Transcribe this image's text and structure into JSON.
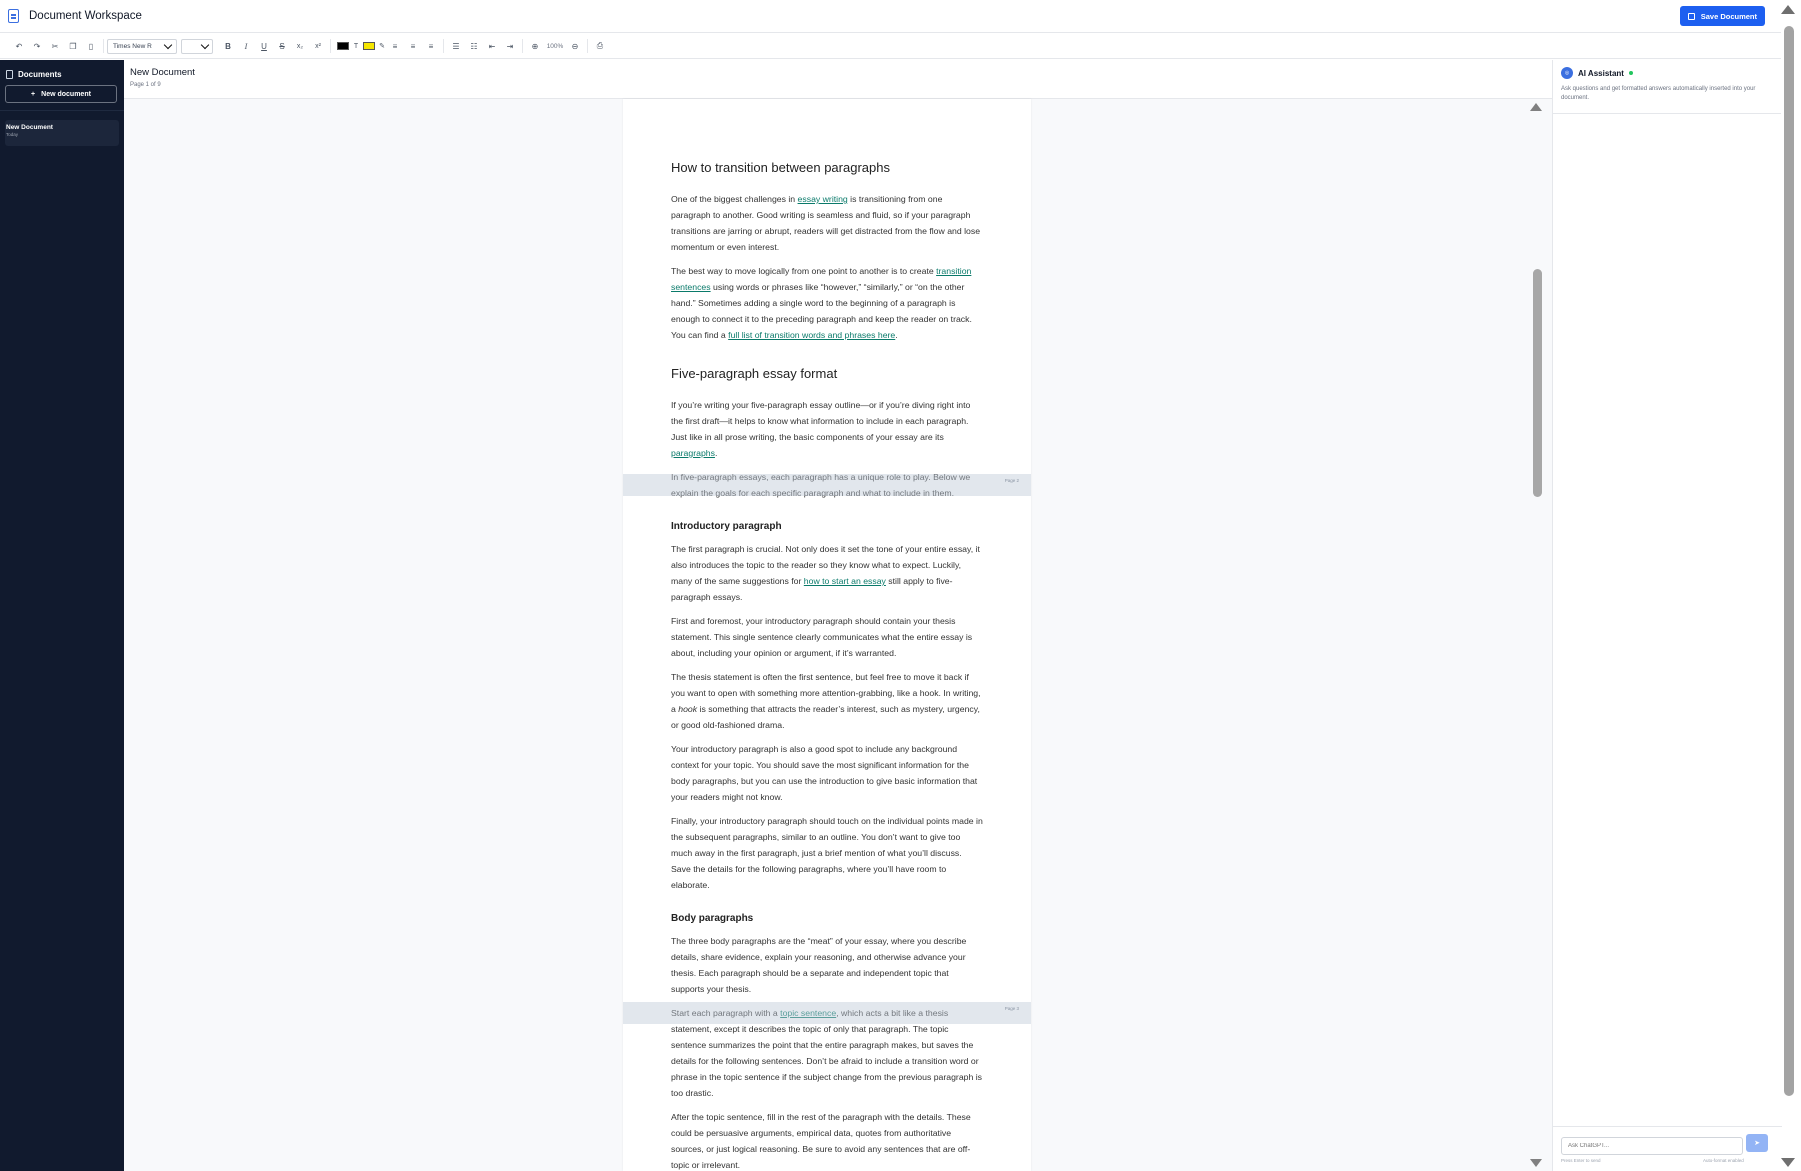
{
  "app": {
    "title": "Document Workspace",
    "save_label": "Save Document"
  },
  "toolbar": {
    "font": "Times New R",
    "zoom": "100%",
    "text_color": "#000000",
    "highlight_color": "#f5e600"
  },
  "sidebar": {
    "heading": "Documents",
    "new_label": "New document",
    "items": [
      {
        "name": "New Document",
        "date": "Today"
      }
    ]
  },
  "document": {
    "title": "New Document",
    "pages": "Page 1 of 9",
    "page_labels": [
      "Page 2",
      "Page 3"
    ],
    "h_transition": "How to transition between paragraphs",
    "p1": {
      "a": "One of the biggest challenges in ",
      "link": "essay writing",
      "b": " is transitioning from one paragraph to another. Good writing is seamless and fluid, so if your paragraph transitions are jarring or abrupt, readers will get distracted from the flow and lose momentum or even interest."
    },
    "p2": {
      "a": "The best way to move logically from one point to another is to create ",
      "link1": "transition sentences",
      "b": " using words or phrases like “however,” “similarly,” or “on the other hand.” Sometimes adding a single word to the beginning of a paragraph is enough to connect it to the preceding paragraph and keep the reader on track. You can find a ",
      "link2": "full list of transition words and phrases here",
      "c": "."
    },
    "h_five": "Five-paragraph essay format",
    "p3": {
      "a": "If you’re writing your five-paragraph essay outline—or if you’re diving right into the first draft—it helps to know what information to include in each paragraph. Just like in all prose writing, the basic components of your essay are its ",
      "link": "paragraphs",
      "b": "."
    },
    "p4": "In five-paragraph essays, each paragraph has a unique role to play. Below we explain the goals for each specific paragraph and what to include in them.",
    "h_intro": "Introductory paragraph",
    "p5": {
      "a": "The first paragraph is crucial. Not only does it set the tone of your entire essay, it also introduces the topic to the reader so they know what to expect. Luckily, many of the same suggestions for ",
      "link": "how to start an essay",
      "b": " still apply to five-paragraph essays."
    },
    "p6": "First and foremost, your introductory paragraph should contain your thesis statement. This single sentence clearly communicates what the entire essay is about, including your opinion or argument, if it’s warranted.",
    "p7": {
      "a": "The thesis statement is often the first sentence, but feel free to move it back if you want to open with something more attention-grabbing, like a hook. In writing, a ",
      "em": "hook",
      "b": " is something that attracts the reader’s interest, such as mystery, urgency, or good old-fashioned drama."
    },
    "p8": "Your introductory paragraph is also a good spot to include any background context for your topic. You should save the most significant information for the body paragraphs, but you can use the introduction to give basic information that your readers might not know.",
    "p9": "Finally, your introductory paragraph should touch on the individual points made in the subsequent paragraphs, similar to an outline. You don’t want to give too much away in the first paragraph, just a brief mention of what you’ll discuss. Save the details for the following paragraphs, where you’ll have room to elaborate.",
    "h_body": "Body paragraphs",
    "p10": "The three body paragraphs are the “meat” of your essay, where you describe details, share evidence, explain your reasoning, and otherwise advance your thesis. Each paragraph should be a separate and independent topic that supports your thesis.",
    "p11": {
      "a": "Start each paragraph with a ",
      "link": "topic sentence",
      "b": ", which acts a bit like a thesis statement, except it describes the topic of only that paragraph. The topic sentence summarizes the point that the entire paragraph makes, but saves the details for the following sentences. Don’t be afraid to include a transition word or phrase in the topic sentence if the subject change from the previous paragraph is too drastic."
    },
    "p12": "After the topic sentence, fill in the rest of the paragraph with the details. These could be persuasive arguments, empirical data, quotes from authoritative sources, or just logical reasoning. Be sure to avoid any sentences that are off-topic or irrelevant."
  },
  "ai": {
    "title": "AI Assistant",
    "description": "Ask questions and get formatted answers automatically inserted into your document.",
    "placeholder": "Ask ChatGPT...",
    "hint": "Press Enter to send",
    "auto": "Auto-format enabled"
  }
}
